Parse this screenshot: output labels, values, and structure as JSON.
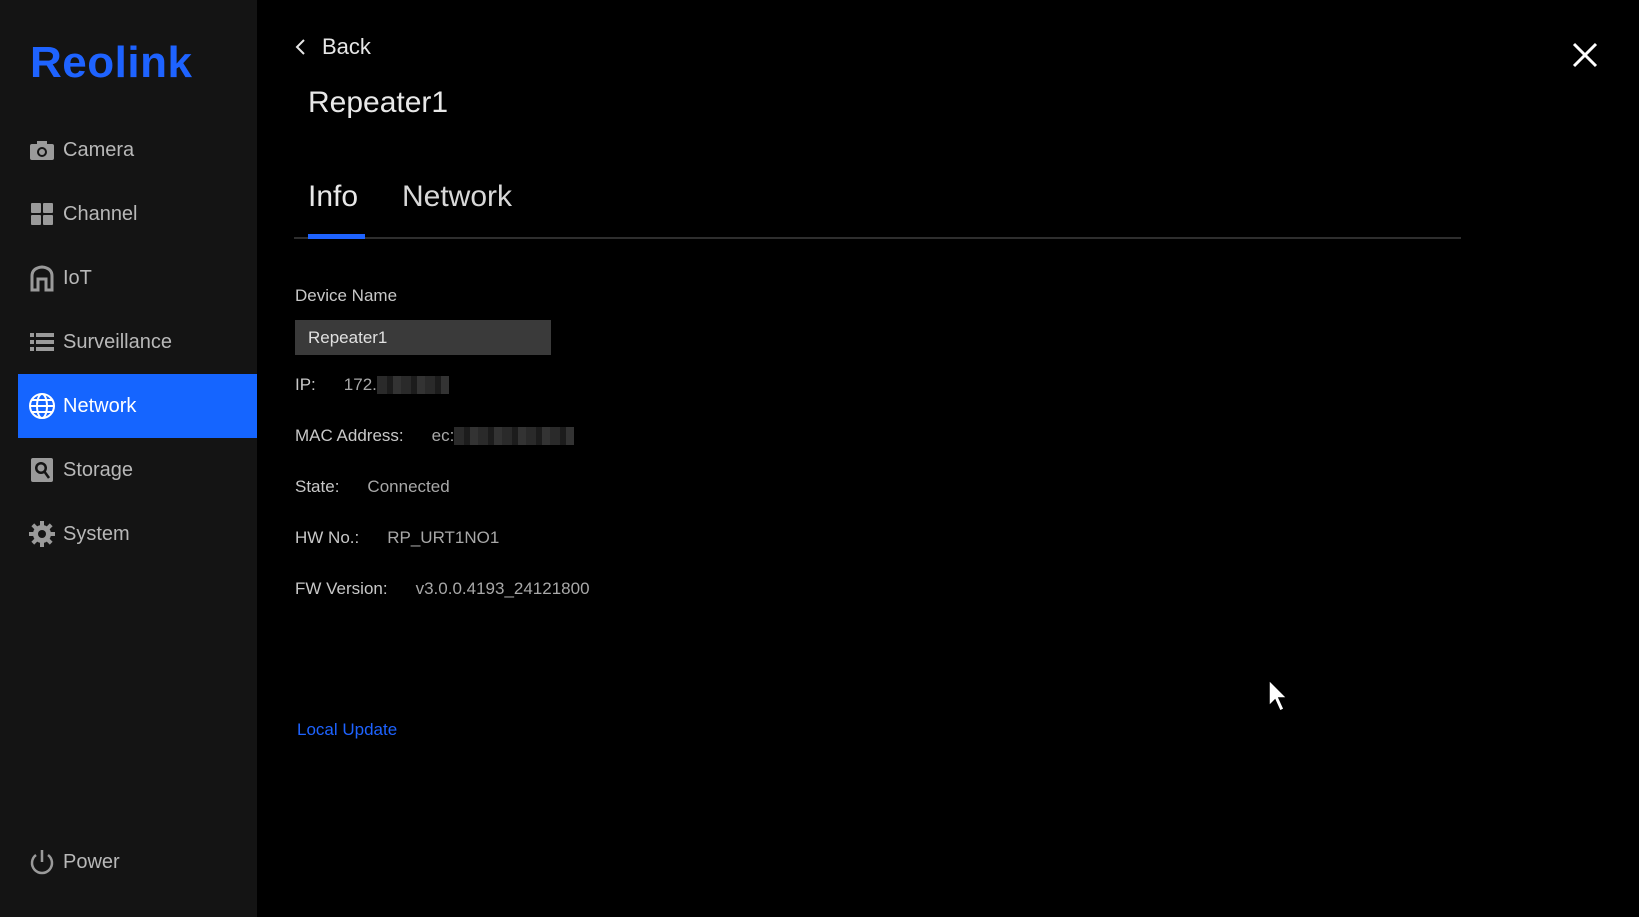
{
  "brand": {
    "logo_text": "Reolink",
    "accent_color": "#1e63ff"
  },
  "sidebar": {
    "items": [
      {
        "label": "Camera",
        "icon": "camera-icon",
        "active": false
      },
      {
        "label": "Channel",
        "icon": "grid-icon",
        "active": false
      },
      {
        "label": "IoT",
        "icon": "home-icon",
        "active": false
      },
      {
        "label": "Surveillance",
        "icon": "list-icon",
        "active": false
      },
      {
        "label": "Network",
        "icon": "globe-icon",
        "active": true
      },
      {
        "label": "Storage",
        "icon": "hdd-icon",
        "active": false
      },
      {
        "label": "System",
        "icon": "gear-icon",
        "active": false
      }
    ],
    "power_label": "Power"
  },
  "header": {
    "back_label": "Back",
    "title": "Repeater1"
  },
  "tabs": [
    {
      "label": "Info",
      "active": true
    },
    {
      "label": "Network",
      "active": false
    }
  ],
  "info": {
    "device_name_label": "Device Name",
    "device_name_value": "Repeater1",
    "ip_label": "IP:",
    "ip_value": "172.",
    "mac_label": "MAC Address:",
    "mac_value": "ec:",
    "state_label": "State:",
    "state_value": "Connected",
    "hw_label": "HW No.:",
    "hw_value": "RP_URT1NO1",
    "fw_label": "FW Version:",
    "fw_value": "v3.0.0.4193_24121800"
  },
  "actions": {
    "local_update_label": "Local Update"
  }
}
